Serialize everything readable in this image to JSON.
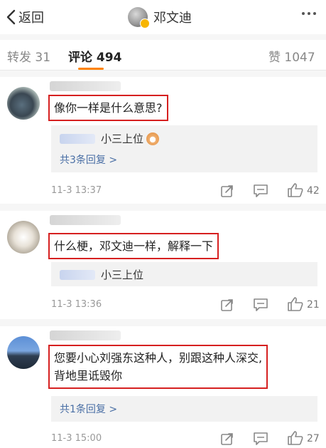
{
  "header": {
    "back_label": "返回",
    "title": "邓文迪"
  },
  "tabs": {
    "repost_label": "转发",
    "repost_count": "31",
    "comment_label": "评论",
    "comment_count": "494",
    "like_label": "赞",
    "like_count": "1047"
  },
  "comments": [
    {
      "text": "像你一样是什么意思?",
      "reply_preview": "小三上位",
      "reply_more": "共3条回复 >",
      "time": "11-3 13:37",
      "likes": "42"
    },
    {
      "text": "什么梗，邓文迪一样，解释一下",
      "reply_preview": "小三上位",
      "time": "11-3 13:36",
      "likes": "21"
    },
    {
      "text_line1": "您要小心刘强东这种人，别跟这种人深交,",
      "text_line2": "背地里诋毁你",
      "reply_more": "共1条回复 >",
      "time": "11-3 15:00",
      "likes": "27"
    }
  ],
  "colors": {
    "highlight_border": "#d62020",
    "tab_accent": "#ff8200",
    "link_blue": "#4a6fa5"
  },
  "icons": [
    "back-chevron-icon",
    "verified-badge-icon",
    "more-dots-icon",
    "share-icon",
    "comment-icon",
    "like-icon",
    "emoji-icon"
  ]
}
